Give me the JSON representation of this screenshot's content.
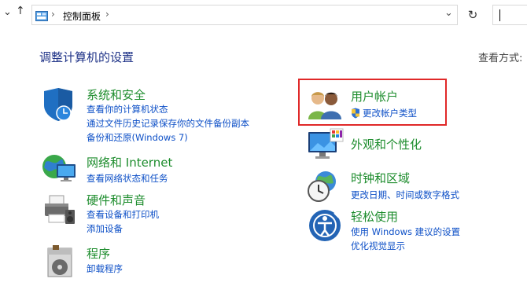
{
  "toolbar": {
    "down_arrow": "⌄",
    "up_arrow": "↑",
    "address_icon": "control-panel-icon",
    "breadcrumb_sep": "›",
    "breadcrumb": "控制面板",
    "breadcrumb_chevron": "›",
    "dropdown": "⌄",
    "refresh": "↻"
  },
  "content": {
    "title": "调整计算机的设置",
    "view_by_label": "查看方式:"
  },
  "categories": [
    {
      "title": "系统和安全",
      "links": [
        "查看你的计算机状态",
        "通过文件历史记录保存你的文件备份副本",
        "备份和还原(Windows 7)"
      ]
    },
    {
      "title": "网络和 Internet",
      "links": [
        "查看网络状态和任务"
      ]
    },
    {
      "title": "硬件和声音",
      "links": [
        "查看设备和打印机",
        "添加设备"
      ]
    },
    {
      "title": "程序",
      "links": [
        "卸载程序"
      ]
    },
    {
      "title": "用户帐户",
      "links": [
        "更改帐户类型"
      ]
    },
    {
      "title": "外观和个性化",
      "links": []
    },
    {
      "title": "时钟和区域",
      "links": [
        "更改日期、时间或数字格式"
      ]
    },
    {
      "title": "轻松使用",
      "links": [
        "使用 Windows 建议的设置",
        "优化视觉显示"
      ]
    }
  ],
  "colors": {
    "category_title": "#1c8c2c",
    "link": "#0e50c7",
    "highlight_box": "#e02828",
    "page_title": "#1e3287"
  }
}
